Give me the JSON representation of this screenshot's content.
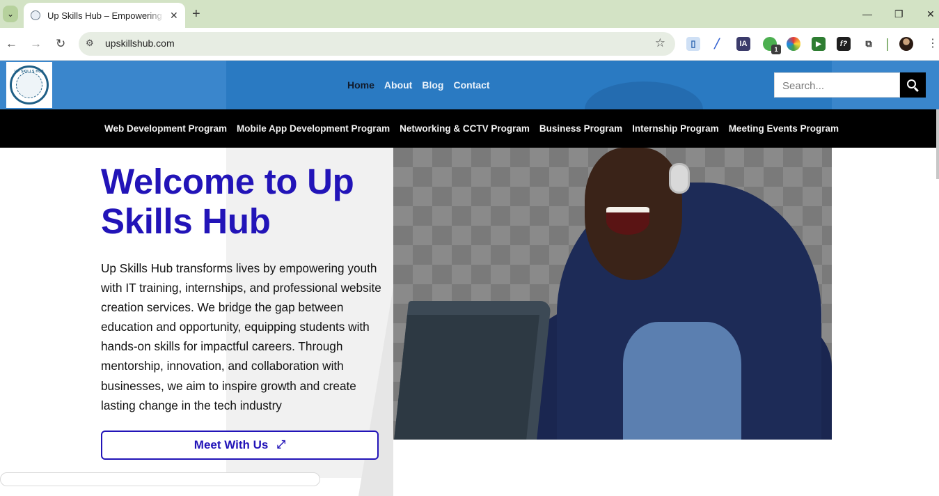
{
  "browser": {
    "tab_title": "Up Skills Hub – Empowering yo",
    "url": "upskillshub.com",
    "new_tab": "+",
    "extension_badge": "1",
    "ext_ia_label": "IA",
    "ext_fx_label": "f?"
  },
  "site": {
    "logo_text": "UP SKILLS HUB",
    "nav": [
      "Home",
      "About",
      "Blog",
      "Contact"
    ],
    "active_nav": "Home",
    "search_placeholder": "Search...",
    "programs": [
      "Web Development Program",
      "Mobile App Development Program",
      "Networking & CCTV Program",
      "Business Program",
      "Internship Program",
      "Meeting Events Program"
    ]
  },
  "hero": {
    "title": "Welcome to Up Skills Hub",
    "description": "Up Skills Hub transforms lives by empowering youth with IT training, internships, and professional website creation services. We bridge the gap between education and opportunity, equipping students with hands-on skills for impactful careers. Through mentorship, innovation, and collaboration with businesses, we aim to inspire growth and create lasting change in the tech industry",
    "cta_label": "Meet With Us"
  },
  "colors": {
    "header_blue": "#2a7ac2",
    "brand_heading": "#2214b8",
    "programs_bar": "#000000"
  }
}
